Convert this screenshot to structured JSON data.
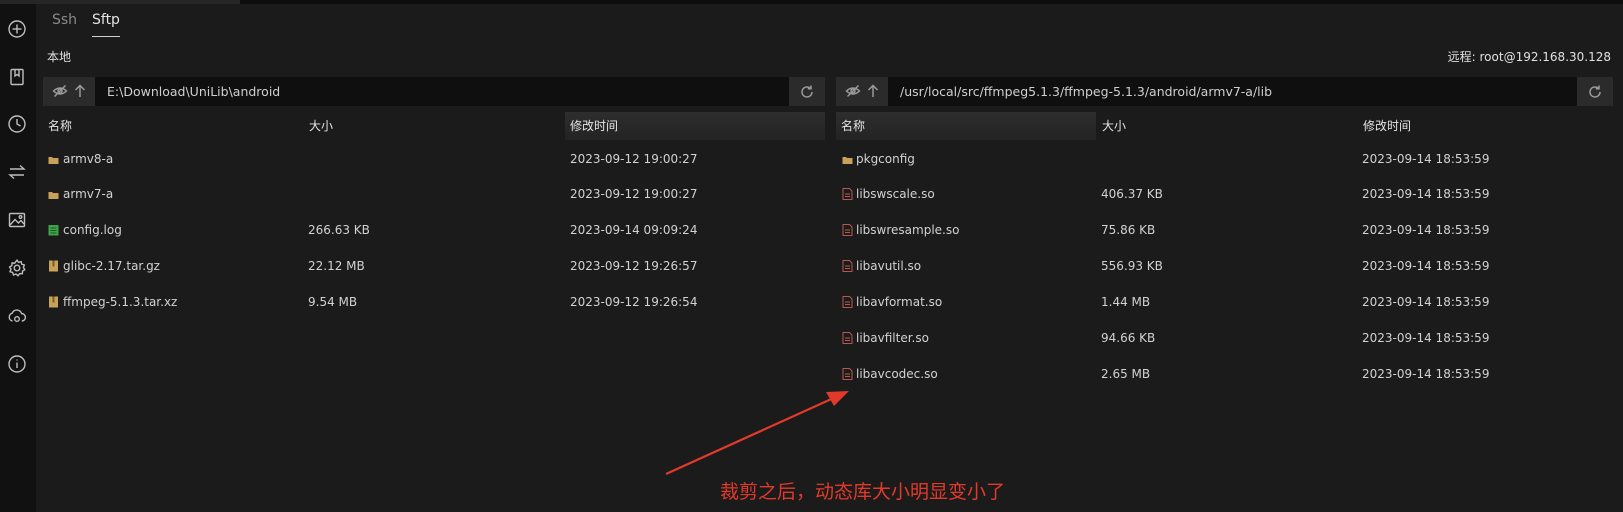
{
  "tabs": [
    "Ssh",
    "Sftp"
  ],
  "local": {
    "label": "本地",
    "path": "E:\\Download\\UniLib\\android",
    "columns": [
      "名称",
      "大小",
      "修改时间"
    ],
    "rows": [
      {
        "name": "armv8-a",
        "size": "",
        "mtime": "2023-09-12 19:00:27",
        "icon": "folder-icon"
      },
      {
        "name": "armv7-a",
        "size": "",
        "mtime": "2023-09-12 19:00:27",
        "icon": "folder-icon"
      },
      {
        "name": "config.log",
        "size": "266.63 KB",
        "mtime": "2023-09-14 09:09:24",
        "icon": "log-file-icon"
      },
      {
        "name": "glibc-2.17.tar.gz",
        "size": "22.12 MB",
        "mtime": "2023-09-12 19:26:57",
        "icon": "archive-icon"
      },
      {
        "name": "ffmpeg-5.1.3.tar.xz",
        "size": "9.54 MB",
        "mtime": "2023-09-12 19:26:54",
        "icon": "archive-icon"
      }
    ]
  },
  "remote": {
    "label": "远程: root@192.168.30.128",
    "path": "/usr/local/src/ffmpeg5.1.3/ffmpeg-5.1.3/android/armv7-a/lib",
    "columns": [
      "名称",
      "大小",
      "修改时间"
    ],
    "rows": [
      {
        "name": "pkgconfig",
        "size": "",
        "mtime": "2023-09-14 18:53:59",
        "icon": "folder-icon"
      },
      {
        "name": "libswscale.so",
        "size": "406.37 KB",
        "mtime": "2023-09-14 18:53:59",
        "icon": "so-file-icon"
      },
      {
        "name": "libswresample.so",
        "size": "75.86 KB",
        "mtime": "2023-09-14 18:53:59",
        "icon": "so-file-icon"
      },
      {
        "name": "libavutil.so",
        "size": "556.93 KB",
        "mtime": "2023-09-14 18:53:59",
        "icon": "so-file-icon"
      },
      {
        "name": "libavformat.so",
        "size": "1.44 MB",
        "mtime": "2023-09-14 18:53:59",
        "icon": "so-file-icon"
      },
      {
        "name": "libavfilter.so",
        "size": "94.66 KB",
        "mtime": "2023-09-14 18:53:59",
        "icon": "so-file-icon"
      },
      {
        "name": "libavcodec.so",
        "size": "2.65 MB",
        "mtime": "2023-09-14 18:53:59",
        "icon": "so-file-icon"
      }
    ]
  },
  "annotation": {
    "text": "裁剪之后，动态库大小明显变小了",
    "color": "#e23a2a"
  },
  "sidebar_icons": [
    "add-icon",
    "bookmark-icon",
    "history-icon",
    "transfer-icon",
    "image-icon",
    "settings-icon",
    "cloud-sync-icon",
    "info-icon"
  ],
  "colors": {
    "background": "#1b1b1b",
    "rail": "#111111",
    "annotation": "#e23a2a",
    "folder": "#c9a25a",
    "so_file": "#b5584d",
    "log_file": "#3fa34a"
  }
}
